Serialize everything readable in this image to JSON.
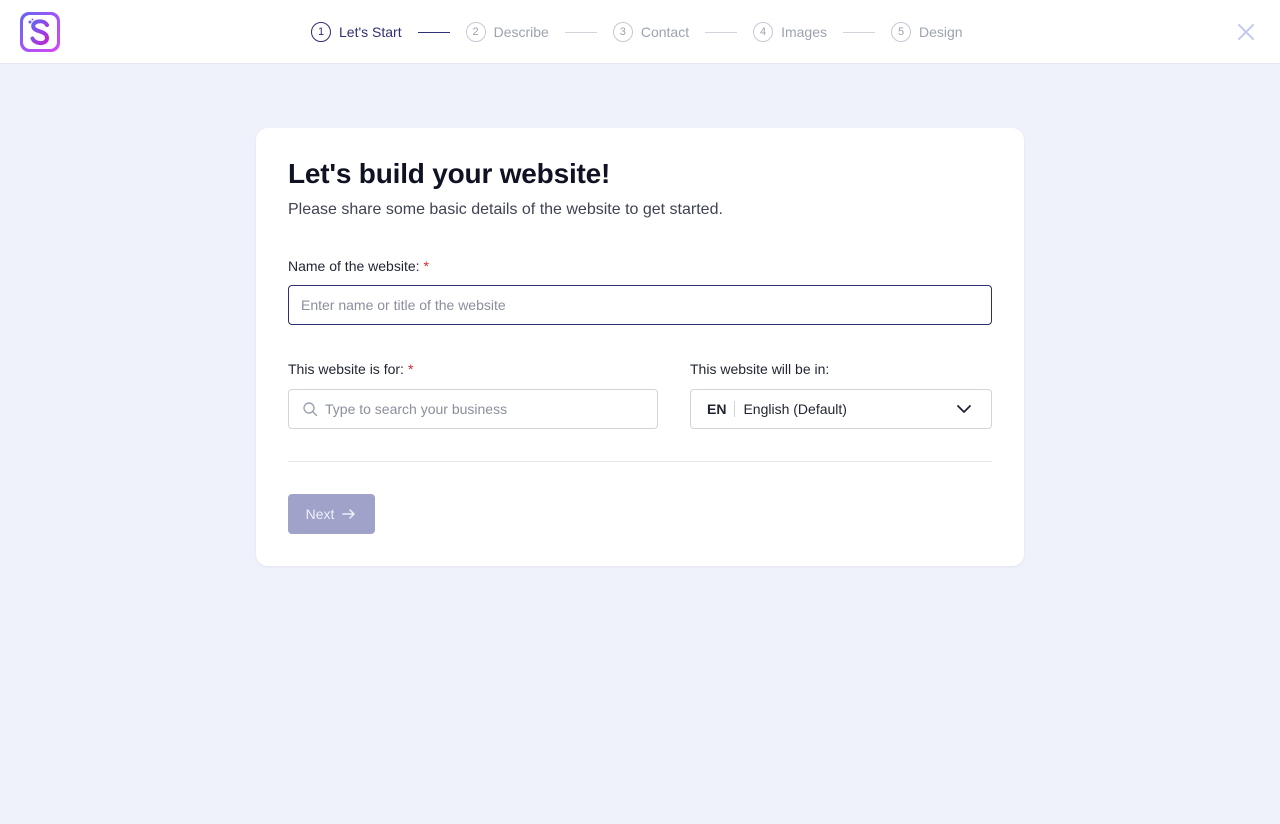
{
  "header": {
    "logo_icon": "letter-s-logo",
    "close_icon": "close-icon",
    "steps": [
      {
        "number": "1",
        "label": "Let's Start",
        "active": true
      },
      {
        "number": "2",
        "label": "Describe",
        "active": false
      },
      {
        "number": "3",
        "label": "Contact",
        "active": false
      },
      {
        "number": "4",
        "label": "Images",
        "active": false
      },
      {
        "number": "5",
        "label": "Design",
        "active": false
      }
    ]
  },
  "card": {
    "title": "Let's build your website!",
    "subtitle": "Please share some basic details of the website to get started.",
    "name_field": {
      "label": "Name of the website:",
      "required_mark": "*",
      "value": "",
      "placeholder": "Enter name or title of the website"
    },
    "business_field": {
      "label": "This website is for:",
      "required_mark": "*",
      "value": "",
      "placeholder": "Type to search your business",
      "icon": "search-icon"
    },
    "language_field": {
      "label": "This website will be in:",
      "code": "EN",
      "selected": "English (Default)",
      "icon": "chevron-down-icon"
    },
    "next_button": {
      "label": "Next",
      "icon": "arrow-right-icon",
      "disabled": true
    }
  },
  "colors": {
    "page_background": "#eff2fb",
    "accent": "#2f2f73",
    "required": "#dc2626",
    "button_disabled": "#9fa2c9",
    "logo_gradient": [
      "#6366f1",
      "#a855f7",
      "#d946ef"
    ]
  }
}
